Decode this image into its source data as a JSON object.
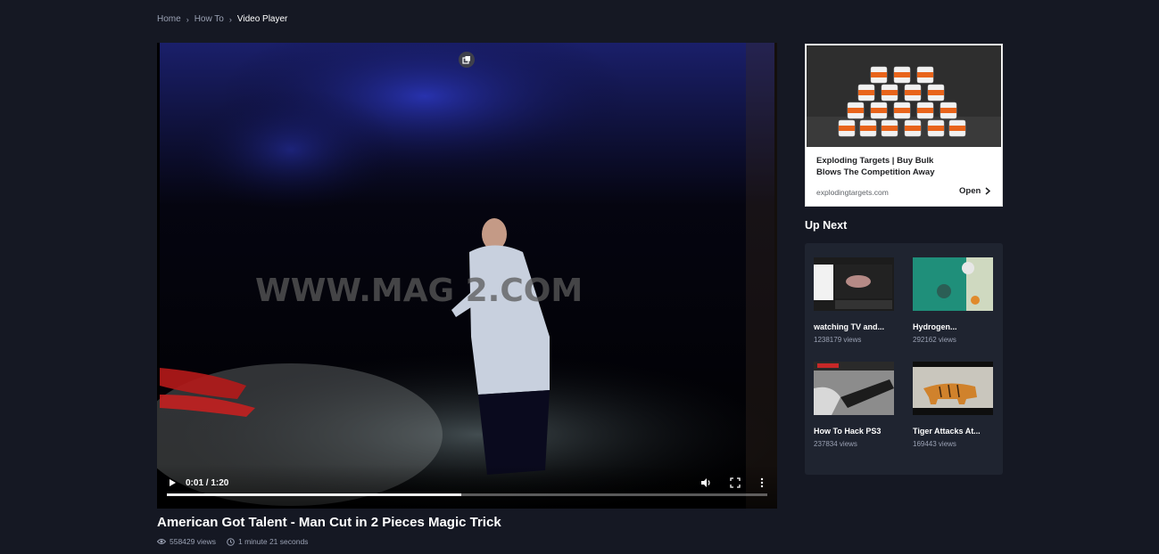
{
  "breadcrumb": {
    "home": "Home",
    "howto": "How To",
    "current": "Video Player"
  },
  "player": {
    "time": "0:01 / 1:20",
    "watermark": "WWW.MAG   2.COM",
    "progress_fraction": 0.49
  },
  "video": {
    "title": "American Got Talent - Man Cut in 2 Pieces Magic Trick",
    "views": "558429 views",
    "duration": "1 minute 21 seconds"
  },
  "ad": {
    "title": "Exploding Targets | Buy Bulk Blows The Competition Away",
    "domain": "explodingtargets.com",
    "open": "Open"
  },
  "upnext": {
    "heading": "Up Next",
    "items": [
      {
        "title": "watching TV and...",
        "views": "1238179 views"
      },
      {
        "title": "Hydrogen...",
        "views": "292162 views"
      },
      {
        "title": "How To Hack PS3",
        "views": "237834 views"
      },
      {
        "title": "Tiger Attacks At...",
        "views": "169443 views"
      }
    ]
  },
  "colors": {
    "background": "#151823",
    "panel": "#1f2430",
    "muted": "#9aa1b3"
  }
}
